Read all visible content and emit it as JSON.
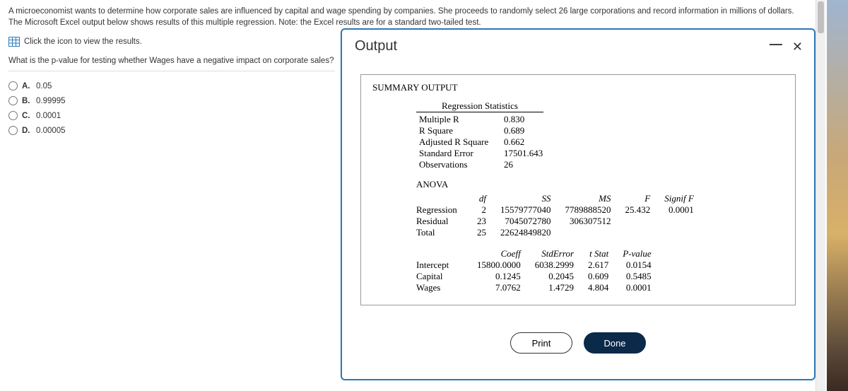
{
  "intro": "A microeconomist wants to determine how corporate sales are influenced by capital and wage spending by companies. She proceeds to randomly select 26 large corporations and record information in millions of dollars. The Microsoft Excel output below shows results of this multiple regression. Note: the Excel results are for a standard two-tailed test.",
  "view_link": "Click the icon to view the results.",
  "question": "What is the p-value for testing whether Wages have a negative impact on corporate sales?",
  "choices": {
    "A": "0.05",
    "B": "0.99995",
    "C": "0.0001",
    "D": "0.00005"
  },
  "modal": {
    "title": "Output",
    "summary_label": "SUMMARY OUTPUT",
    "stats_header": "Regression Statistics",
    "stats": {
      "multiple_r": {
        "label": "Multiple R",
        "value": "0.830"
      },
      "r_square": {
        "label": "R Square",
        "value": "0.689"
      },
      "adj_r": {
        "label": "Adjusted R Square",
        "value": "0.662"
      },
      "std_err": {
        "label": "Standard Error",
        "value": "17501.643"
      },
      "obs": {
        "label": "Observations",
        "value": "26"
      }
    },
    "anova_label": "ANOVA",
    "anova_headers": {
      "src": "",
      "df": "df",
      "ss": "SS",
      "ms": "MS",
      "f": "F",
      "sig": "Signif F"
    },
    "anova": {
      "regression": {
        "label": "Regression",
        "df": "2",
        "ss": "15579777040",
        "ms": "7789888520",
        "f": "25.432",
        "sig": "0.0001"
      },
      "residual": {
        "label": "Residual",
        "df": "23",
        "ss": "7045072780",
        "ms": "306307512",
        "f": "",
        "sig": ""
      },
      "total": {
        "label": "Total",
        "df": "25",
        "ss": "22624849820",
        "ms": "",
        "f": "",
        "sig": ""
      }
    },
    "coef_headers": {
      "src": "",
      "coeff": "Coeff",
      "stderr": "StdError",
      "tstat": "t Stat",
      "pval": "P-value"
    },
    "coef": {
      "intercept": {
        "label": "Intercept",
        "coeff": "15800.0000",
        "stderr": "6038.2999",
        "tstat": "2.617",
        "pval": "0.0154"
      },
      "capital": {
        "label": "Capital",
        "coeff": "0.1245",
        "stderr": "0.2045",
        "tstat": "0.609",
        "pval": "0.5485"
      },
      "wages": {
        "label": "Wages",
        "coeff": "7.0762",
        "stderr": "1.4729",
        "tstat": "4.804",
        "pval": "0.0001"
      }
    },
    "buttons": {
      "print": "Print",
      "done": "Done"
    }
  }
}
